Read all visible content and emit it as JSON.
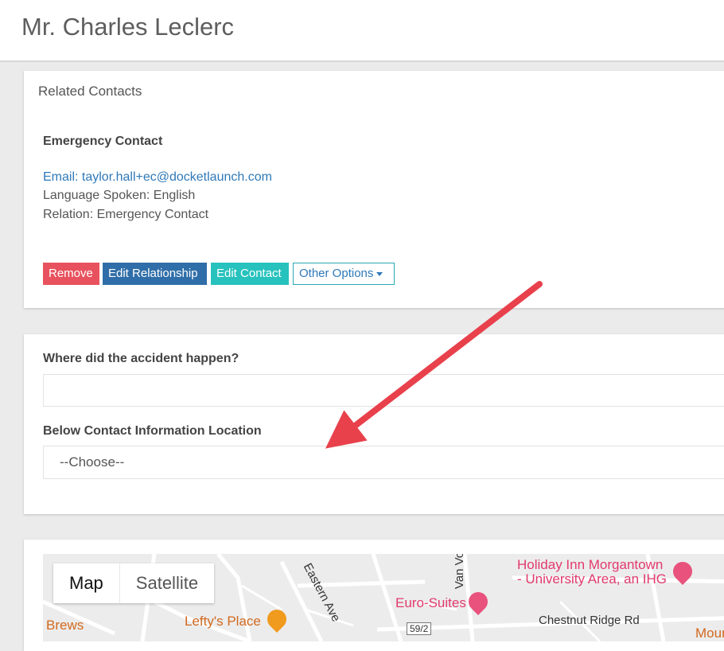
{
  "page": {
    "title": "Mr. Charles Leclerc"
  },
  "related_contacts": {
    "heading": "Related Contacts",
    "contact_type": "Emergency Contact",
    "email": "Email: taylor.hall+ec@docketlaunch.com",
    "language": "Language Spoken: English",
    "relation": "Relation: Emergency Contact",
    "buttons": {
      "remove": "Remove",
      "edit_relationship": "Edit Relationship",
      "edit_contact": "Edit Contact",
      "other_options": "Other Options"
    },
    "colors": {
      "remove": "#e8525e",
      "edit_relationship": "#2f6ea8",
      "edit_contact": "#27c2bd",
      "link": "#2f79b8"
    }
  },
  "accident_form": {
    "question_label": "Where did the accident happen?",
    "question_value": "",
    "location_label": "Below Contact Information Location",
    "location_selected": "--Choose--"
  },
  "map": {
    "map_label": "Map",
    "satellite_label": "Satellite",
    "pois": {
      "holiday_inn_line1": "Holiday Inn Morgantown",
      "holiday_inn_line2": "- University Area, an IHG",
      "euro_suites": "Euro-Suites",
      "leftys": "Lefty's Place",
      "brews": "Brews",
      "mountain": "Mountai"
    },
    "roads": {
      "chestnut": "Chestnut Ridge Rd",
      "eastern": "Eastern Ave",
      "van_voorhis": "Van Vo",
      "shield": "59/2"
    },
    "icons": {
      "hotel": "bed-icon",
      "restaurant": "fork-knife-icon"
    }
  }
}
